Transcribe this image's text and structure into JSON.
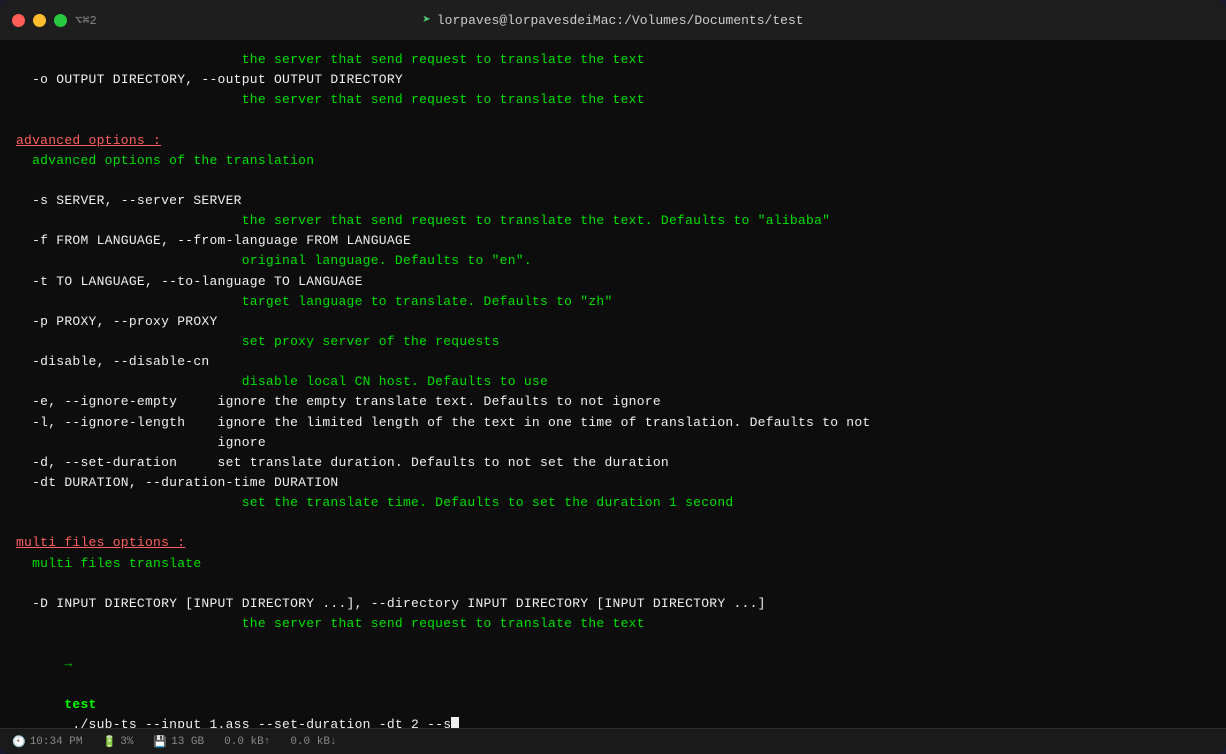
{
  "titlebar": {
    "shortcut": "⌥⌘2",
    "title": "lorpaves@lorpavesdeiMac:/Volumes/Documents/test",
    "icon": "➤"
  },
  "terminal": {
    "lines": [
      {
        "type": "green-indent",
        "text": "                            the server that send request to translate the text"
      },
      {
        "type": "white",
        "text": "  -o OUTPUT DIRECTORY, --output OUTPUT DIRECTORY"
      },
      {
        "type": "green-indent",
        "text": "                            the server that send request to translate the text"
      },
      {
        "type": "blank",
        "text": ""
      },
      {
        "type": "red-section",
        "text": "advanced options :",
        "suffix": ""
      },
      {
        "type": "green-indent2",
        "text": "  advanced options of the translation"
      },
      {
        "type": "blank",
        "text": ""
      },
      {
        "type": "white",
        "text": "  -s SERVER, --server SERVER"
      },
      {
        "type": "green-indent",
        "text": "                            the server that send request to translate the text. Defaults to \"alibaba\""
      },
      {
        "type": "white",
        "text": "  -f FROM LANGUAGE, --from-language FROM LANGUAGE"
      },
      {
        "type": "green-indent",
        "text": "                            original language. Defaults to \"en\"."
      },
      {
        "type": "white",
        "text": "  -t TO LANGUAGE, --to-language TO LANGUAGE"
      },
      {
        "type": "green-indent",
        "text": "                            target language to translate. Defaults to \"zh\""
      },
      {
        "type": "white",
        "text": "  -p PROXY, --proxy PROXY"
      },
      {
        "type": "green-indent",
        "text": "                            set proxy server of the requests"
      },
      {
        "type": "white",
        "text": "  -disable, --disable-cn"
      },
      {
        "type": "green-indent",
        "text": "                            disable local CN host. Defaults to use"
      },
      {
        "type": "white",
        "text": "  -e, --ignore-empty     ignore the empty translate text. Defaults to not ignore"
      },
      {
        "type": "white",
        "text": "  -l, --ignore-length    ignore the limited length of the text in one time of translation. Defaults to not"
      },
      {
        "type": "white",
        "text": "                         ignore"
      },
      {
        "type": "white",
        "text": "  -d, --set-duration     set translate duration. Defaults to not set the duration"
      },
      {
        "type": "white",
        "text": "  -dt DURATION, --duration-time DURATION"
      },
      {
        "type": "green-indent",
        "text": "                            set the translate time. Defaults to set the duration 1 second"
      },
      {
        "type": "blank",
        "text": ""
      },
      {
        "type": "red-section",
        "text": "multi files options :",
        "suffix": ""
      },
      {
        "type": "green-indent2",
        "text": "  multi files translate"
      },
      {
        "type": "blank",
        "text": ""
      },
      {
        "type": "white",
        "text": "  -D INPUT DIRECTORY [INPUT DIRECTORY ...], --directory INPUT DIRECTORY [INPUT DIRECTORY ...]"
      },
      {
        "type": "green-indent",
        "text": "                            the server that send request to translate the text"
      },
      {
        "type": "command",
        "text": "test ./sub-ts --input 1.ass --set-duration -dt 2 --s"
      }
    ]
  },
  "statusbar": {
    "time": "10:34 PM",
    "battery": "3%",
    "storage": "13 GB",
    "network": "0.0 kB↑",
    "network2": "0.0 kB↓"
  }
}
